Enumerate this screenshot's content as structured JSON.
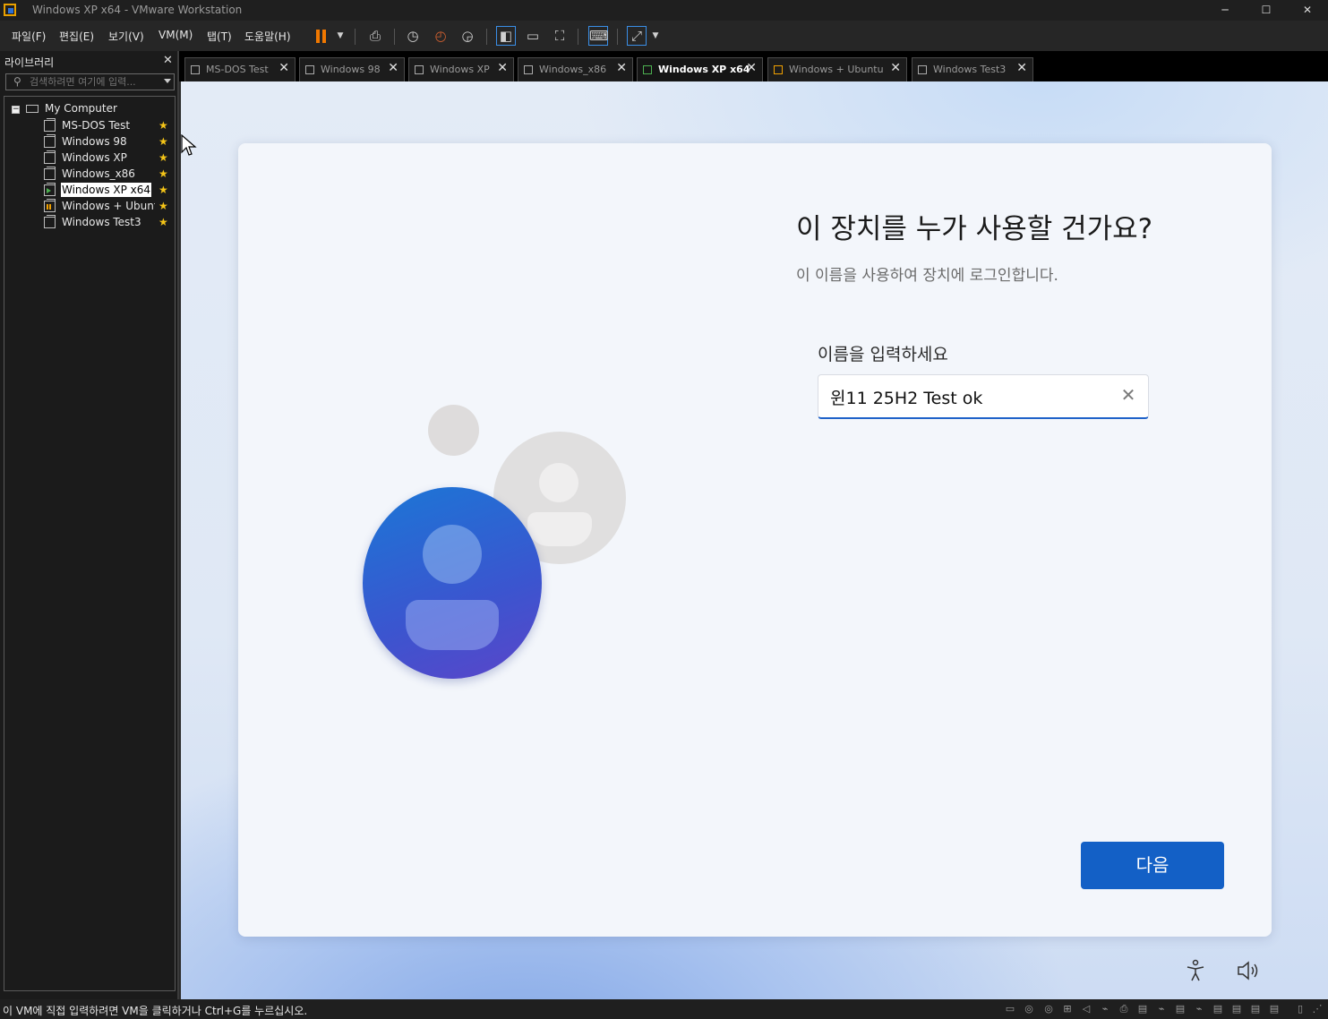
{
  "window": {
    "title": "Windows XP x64 - VMware Workstation",
    "controls": {
      "minimize": "─",
      "maximize": "☐",
      "close": "✕"
    }
  },
  "menu": {
    "items": [
      "파일(F)",
      "편집(E)",
      "보기(V)",
      "VM(M)",
      "탭(T)",
      "도움말(H)"
    ]
  },
  "library": {
    "title": "라이브러리",
    "close": "✕",
    "search_placeholder": "검색하려면 여기에 입력...",
    "root": "My Computer",
    "vms": [
      {
        "name": "MS-DOS Test",
        "state": "off",
        "favorite": true
      },
      {
        "name": "Windows 98",
        "state": "off",
        "favorite": true
      },
      {
        "name": "Windows XP",
        "state": "off",
        "favorite": true
      },
      {
        "name": "Windows_x86",
        "state": "off",
        "favorite": true
      },
      {
        "name": "Windows XP x64",
        "state": "running",
        "favorite": true,
        "selected": true
      },
      {
        "name": "Windows + Ubuntu",
        "state": "paused",
        "favorite": true
      },
      {
        "name": "Windows Test3",
        "state": "off",
        "favorite": true
      }
    ],
    "star": "★"
  },
  "tabs": [
    {
      "label": "MS-DOS Test",
      "active": false
    },
    {
      "label": "Windows 98",
      "active": false
    },
    {
      "label": "Windows XP",
      "active": false
    },
    {
      "label": "Windows_x86",
      "active": false
    },
    {
      "label": "Windows XP x64",
      "active": true
    },
    {
      "label": "Windows + Ubuntu",
      "active": false
    },
    {
      "label": "Windows Test3",
      "active": false
    }
  ],
  "tab_close": "✕",
  "oobe": {
    "heading": "이 장치를 누가 사용할 건가요?",
    "subheading": "이 이름을 사용하여 장치에 로그인합니다.",
    "field_label": "이름을 입력하세요",
    "name_value": "윈11 25H2 Test ok",
    "clear": "✕",
    "next_button": "다음"
  },
  "status": {
    "text": "이 VM에 직접 입력하려면 VM을 클릭하거나 Ctrl+G를 누르십시오."
  },
  "colors": {
    "accent": "#1360c6",
    "star": "#f5c518",
    "pause": "#f07800",
    "avatar_gradient_start": "#1b77d6",
    "avatar_gradient_end": "#5b45c9"
  }
}
